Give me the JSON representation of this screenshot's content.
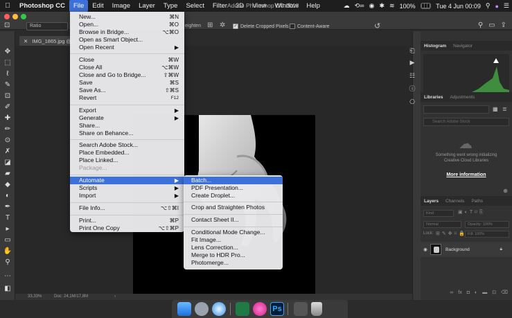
{
  "menubar": {
    "apple_icon": "apple-icon",
    "items": [
      "Photoshop CC",
      "File",
      "Edit",
      "Image",
      "Layer",
      "Type",
      "Select",
      "Filter",
      "3D",
      "View",
      "Window",
      "Help"
    ],
    "active_item": "File",
    "window_title": "Adobe Photoshop CC 2018",
    "battery": "100%",
    "datetime": "Tue 4 Jun  00:09"
  },
  "options_bar": {
    "ratio": "Ratio",
    "straighten": "eighten",
    "delete_cropped": "Delete Cropped Pixels",
    "content_aware": "Content-Aware"
  },
  "document": {
    "tab": "IMG_1865.jpg @",
    "zoom": "33,33%",
    "doc_info": "Doc: 24,1M/17,8M"
  },
  "file_menu": {
    "items": [
      {
        "label": "New...",
        "shortcut": "⌘N"
      },
      {
        "label": "Open...",
        "shortcut": "⌘O"
      },
      {
        "label": "Browse in Bridge...",
        "shortcut": "⌥⌘O"
      },
      {
        "label": "Open as Smart Object...",
        "shortcut": ""
      },
      {
        "label": "Open Recent",
        "shortcut": "▶"
      },
      {
        "label": "Close",
        "shortcut": "⌘W"
      },
      {
        "label": "Close All",
        "shortcut": "⌥⌘W"
      },
      {
        "label": "Close and Go to Bridge...",
        "shortcut": "⇧⌘W"
      },
      {
        "label": "Save",
        "shortcut": "⌘S"
      },
      {
        "label": "Save As...",
        "shortcut": "⇧⌘S"
      },
      {
        "label": "Revert",
        "shortcut": "F12"
      },
      {
        "label": "Export",
        "shortcut": "▶"
      },
      {
        "label": "Generate",
        "shortcut": "▶"
      },
      {
        "label": "Share...",
        "shortcut": ""
      },
      {
        "label": "Share on Behance...",
        "shortcut": ""
      },
      {
        "label": "Search Adobe Stock...",
        "shortcut": ""
      },
      {
        "label": "Place Embedded...",
        "shortcut": ""
      },
      {
        "label": "Place Linked...",
        "shortcut": ""
      },
      {
        "label": "Package...",
        "shortcut": ""
      },
      {
        "label": "Automate",
        "shortcut": "▶"
      },
      {
        "label": "Scripts",
        "shortcut": "▶"
      },
      {
        "label": "Import",
        "shortcut": "▶"
      },
      {
        "label": "File Info...",
        "shortcut": "⌥⇧⌘I"
      },
      {
        "label": "Print...",
        "shortcut": "⌘P"
      },
      {
        "label": "Print One Copy",
        "shortcut": "⌥⇧⌘P"
      }
    ]
  },
  "automate_submenu": {
    "items": [
      "Batch...",
      "PDF Presentation...",
      "Create Droplet...",
      "Crop and Straighten Photos",
      "Contact Sheet II...",
      "Conditional Mode Change...",
      "Fit Image...",
      "Lens Correction...",
      "Merge to HDR Pro...",
      "Photomerge..."
    ]
  },
  "panels": {
    "histogram_tabs": [
      "Histogram",
      "Navigator"
    ],
    "library_tabs": [
      "Libraries",
      "Adjustments"
    ],
    "library_search": "Search Adobe Stock",
    "library_warning": "Something went wrong initializing Creative Cloud Libraries",
    "more_info": "More information",
    "layers_tabs": [
      "Layers",
      "Channels",
      "Paths"
    ],
    "kind": "Kind",
    "blend_mode": "Normal",
    "opacity": "Opacity: 100%",
    "lock": "Lock:",
    "fill": "Fill: 100%",
    "layer_name": "Background"
  },
  "colors": {
    "accent": "#3d71d9",
    "menu_bg": "#e9e9ec",
    "ps_blue": "#31a8ff"
  }
}
